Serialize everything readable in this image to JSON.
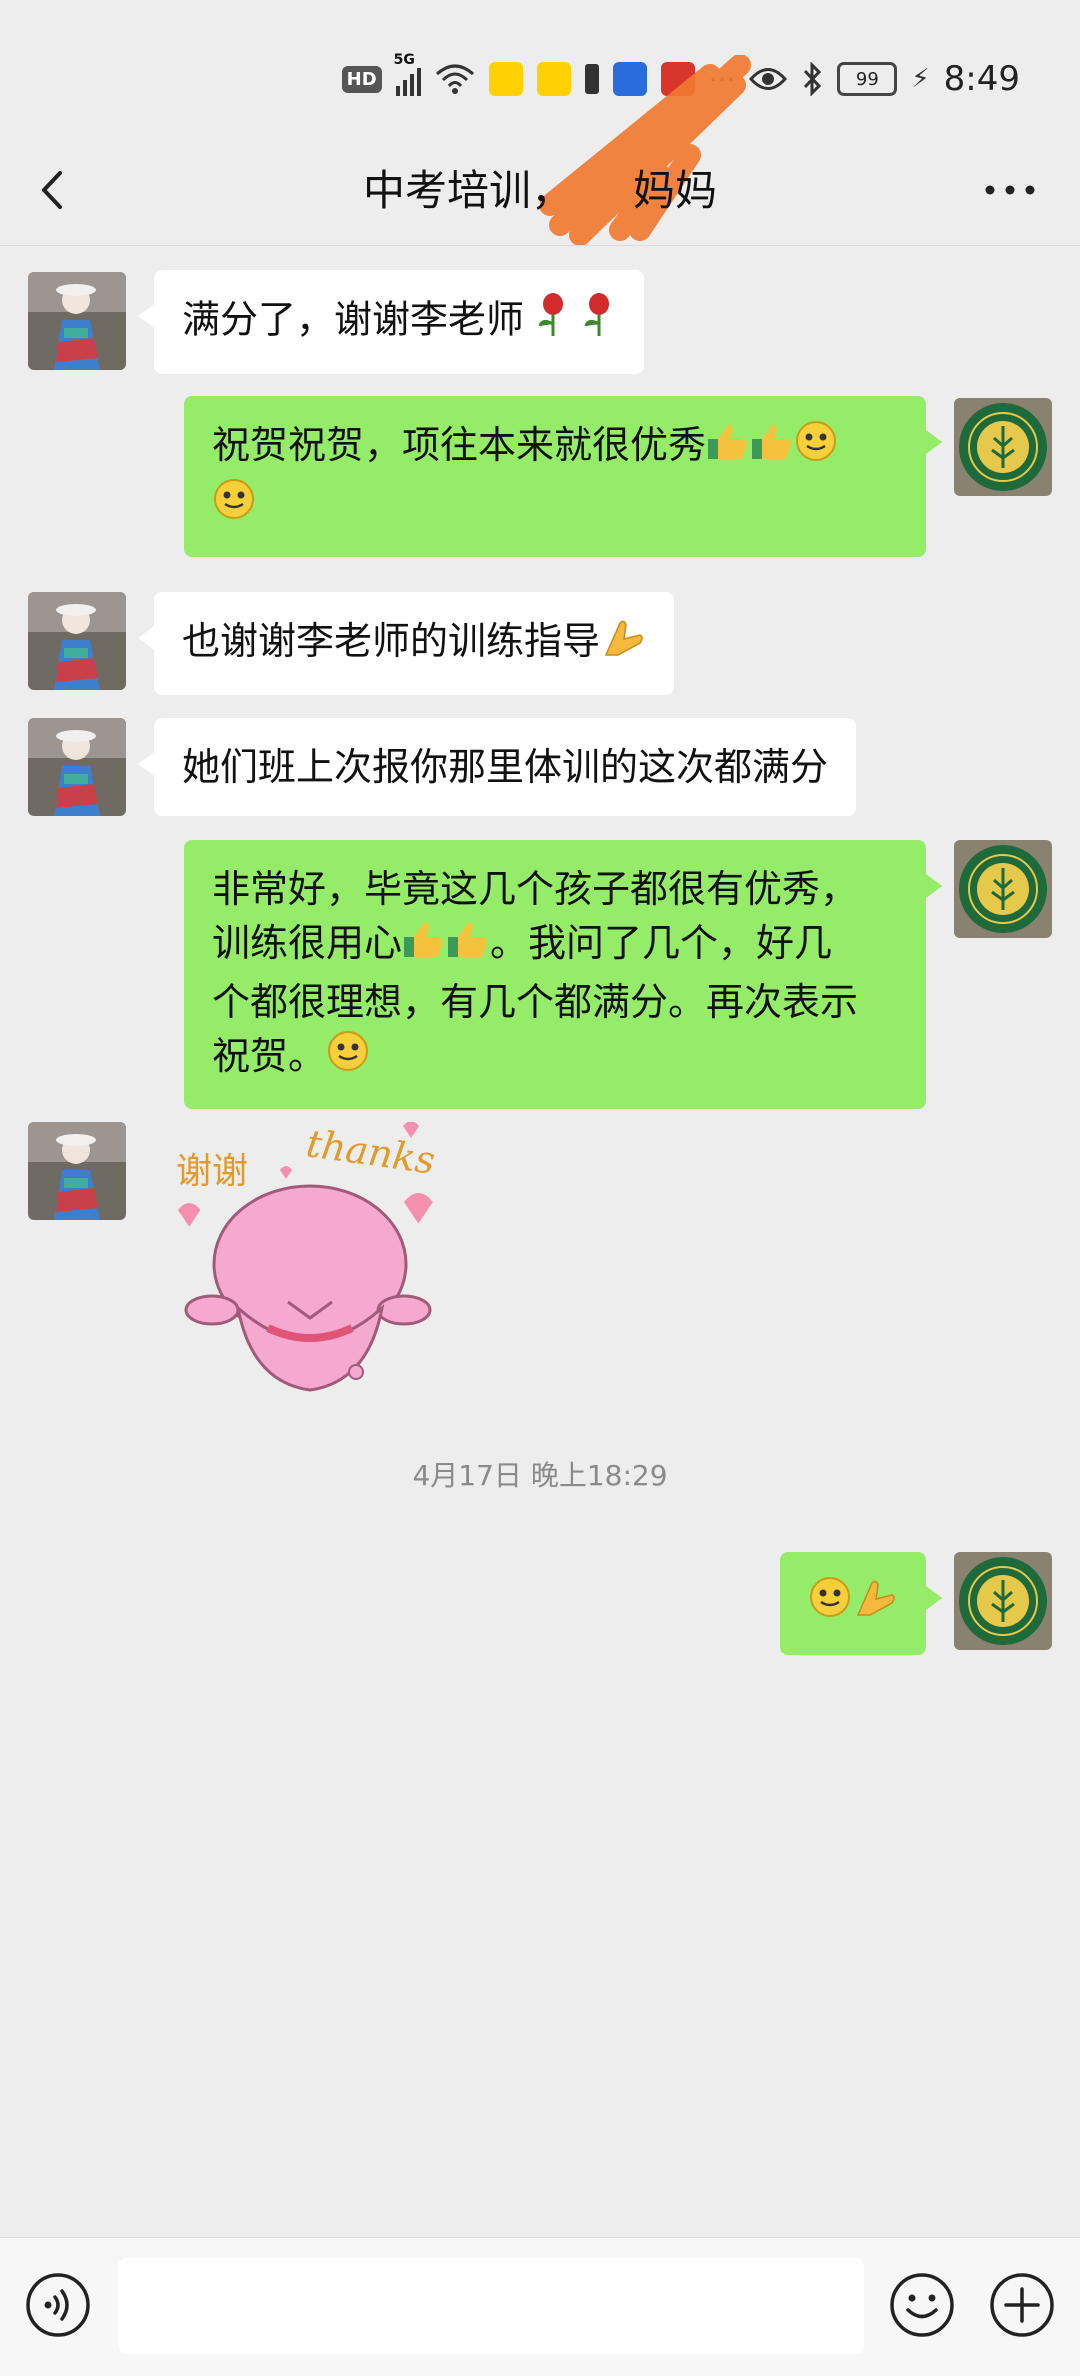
{
  "status_bar": {
    "hd": "HD",
    "network": "5G",
    "battery": "99",
    "time": "8:49"
  },
  "header": {
    "title": "中考培训，",
    "title_suffix": "妈妈"
  },
  "messages": [
    {
      "from": "contact",
      "text": "满分了，谢谢李老师"
    },
    {
      "from": "me",
      "text": "祝贺祝贺，项往本来就很优秀"
    },
    {
      "from": "contact",
      "text": "也谢谢李老师的训练指导"
    },
    {
      "from": "contact",
      "text": "她们班上次报你那里体训的这次都满分"
    },
    {
      "from": "me",
      "text_lines": [
        "非常好，毕竟这几个孩子都很有优秀，",
        "训练很用心",
        "。我问了几个，好几",
        "个都很理想，有几个都满分。再次表示",
        "祝贺。"
      ]
    },
    {
      "from": "contact",
      "sticker_text_left": "谢谢",
      "sticker_text_right": "thanks"
    },
    {
      "from": "me",
      "text": ""
    }
  ],
  "timestamp": "4月17日 晚上18:29",
  "input": {
    "placeholder": ""
  },
  "colors": {
    "background": "#ededed",
    "outgoing_bubble": "#95ec69",
    "incoming_bubble": "#ffffff"
  }
}
